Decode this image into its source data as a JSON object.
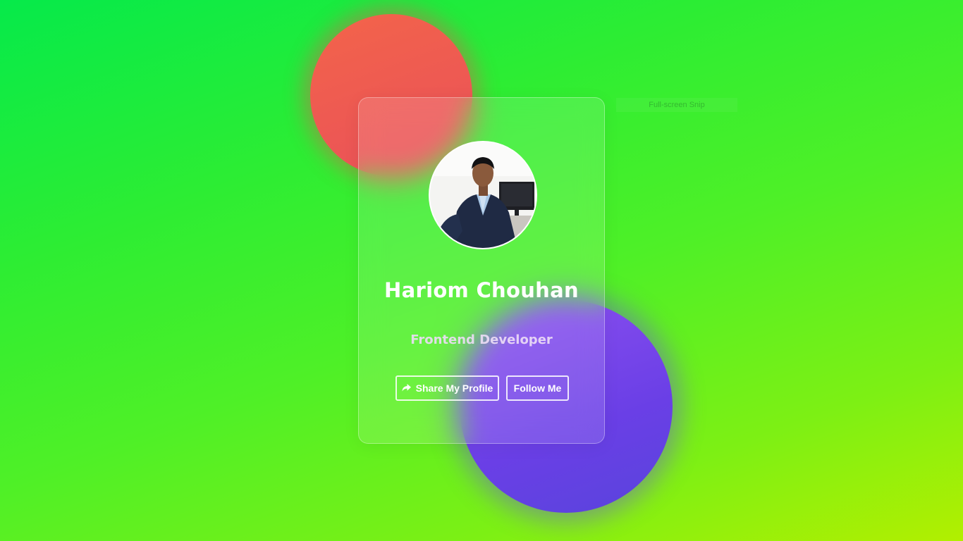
{
  "profile": {
    "name": "Hariom Chouhan",
    "role": "Frontend Developer"
  },
  "actions": {
    "share_label": "Share My Profile",
    "share_icon": "share-arrow-icon",
    "follow_label": "Follow Me"
  },
  "overlay": {
    "snip_label": "Full-screen Snip"
  },
  "colors": {
    "background_start": "#06ea4a",
    "background_end": "#b2ef00",
    "blob_red": "#ee5a52",
    "blob_purple": "#6e43e8",
    "text": "#ffffff"
  }
}
